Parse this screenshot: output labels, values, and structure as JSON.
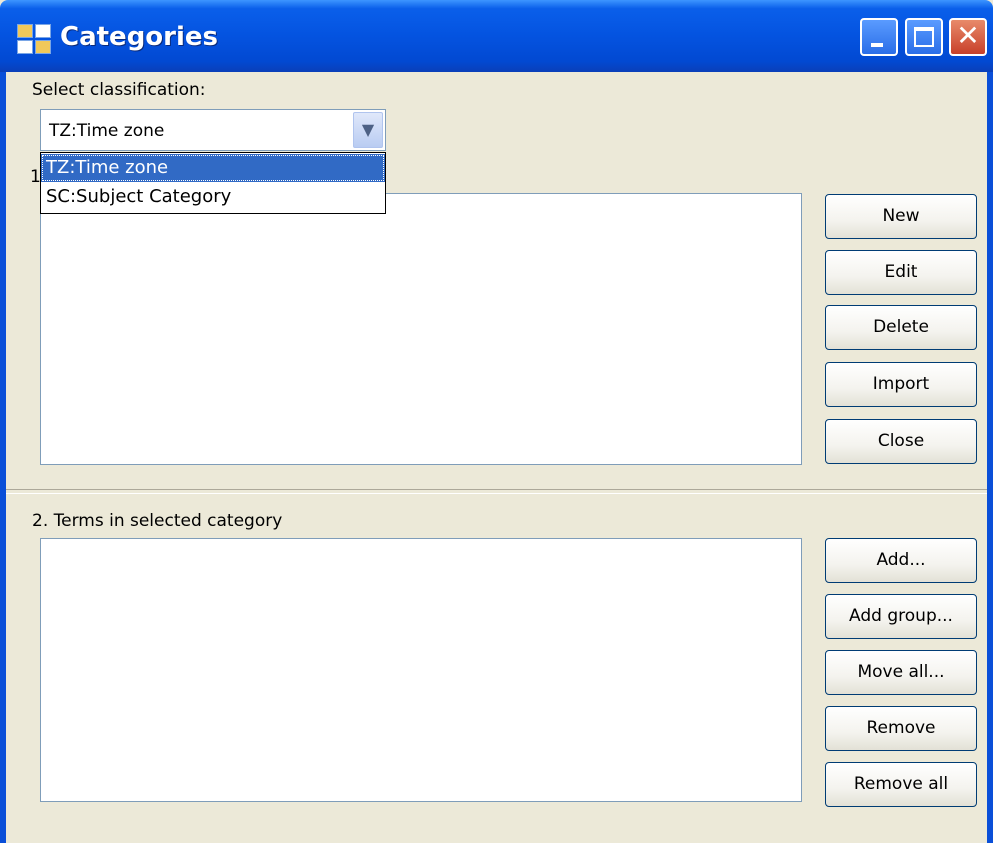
{
  "window": {
    "title": "Categories"
  },
  "labels": {
    "select_classification": "Select classification:",
    "section1_number": "1",
    "terms_in_category": "2. Terms in selected category"
  },
  "combo": {
    "value": "TZ:Time zone",
    "options": [
      "TZ:Time zone",
      "SC:Subject Category"
    ],
    "selected_index": 0
  },
  "buttons_top": [
    "New",
    "Edit",
    "Delete",
    "Import",
    "Close"
  ],
  "buttons_bottom": [
    "Add...",
    "Add group...",
    "Move all...",
    "Remove",
    "Remove all"
  ],
  "colors": {
    "titlebar": "#0453E0",
    "selection": "#316AC5",
    "dialog_bg": "#ECE9D8"
  },
  "icons": {
    "app": "categories-grid-icon",
    "minimize": "minimize-icon",
    "maximize": "maximize-icon",
    "close": "close-icon",
    "dropdown": "chevron-down-icon"
  }
}
